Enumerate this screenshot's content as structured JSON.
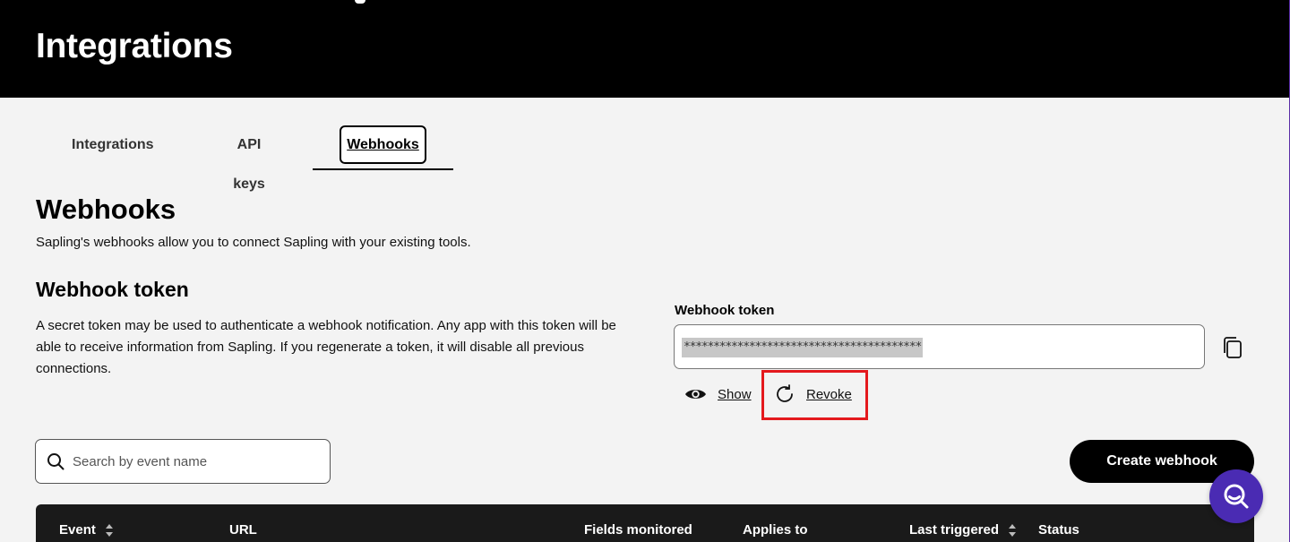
{
  "header": {
    "title": "Integrations"
  },
  "tabs": [
    {
      "label": "Integrations",
      "active": false
    },
    {
      "label": "API keys",
      "active": false
    },
    {
      "label": "Webhooks",
      "active": true
    }
  ],
  "webhooks": {
    "title": "Webhooks",
    "description": "Sapling's webhooks allow you to connect Sapling with your existing tools."
  },
  "token": {
    "title": "Webhook token",
    "description": "A secret token may be used to authenticate a webhook notification. Any app with this token will be able to receive information from Sapling. If you regenerate a token, it will disable all previous connections.",
    "field_label": "Webhook token",
    "masked_value": "****************************************",
    "show_label": "Show",
    "revoke_label": "Revoke"
  },
  "search": {
    "placeholder": "Search by event name",
    "value": ""
  },
  "create_button": {
    "label": "Create webhook"
  },
  "table": {
    "columns": [
      {
        "label": "Event",
        "sortable": true
      },
      {
        "label": "URL",
        "sortable": false
      },
      {
        "label": "Fields monitored",
        "sortable": false
      },
      {
        "label": "Applies to",
        "sortable": false
      },
      {
        "label": "Last triggered",
        "sortable": true
      },
      {
        "label": "Status",
        "sortable": false
      }
    ]
  },
  "colors": {
    "accent": "#4a2bb3",
    "highlight": "#e4191d",
    "header_bg": "#000000"
  },
  "icons": [
    "copy-icon",
    "eye-icon",
    "refresh-icon",
    "search-icon",
    "help-search-icon",
    "sort-icon"
  ]
}
